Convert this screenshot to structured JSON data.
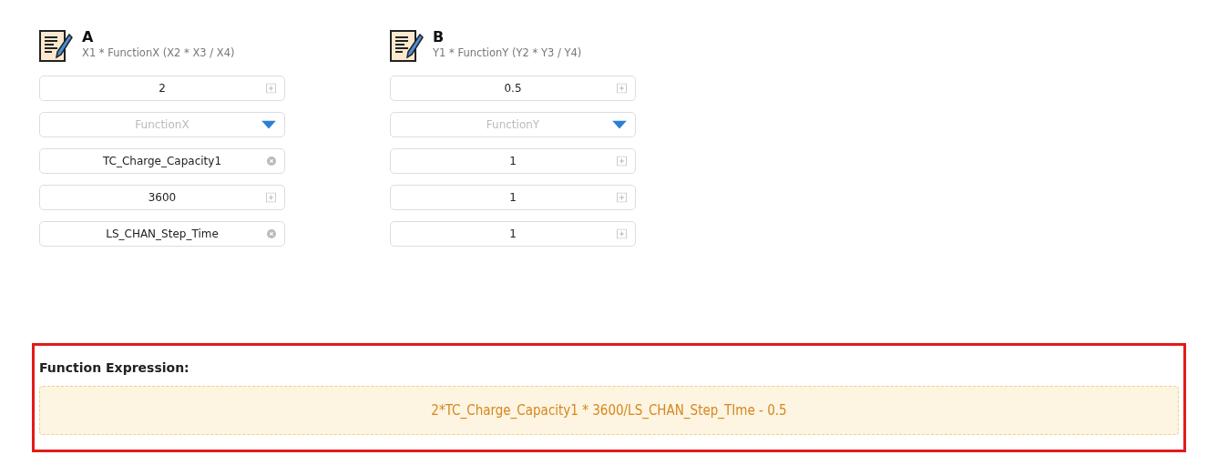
{
  "operands": [
    {
      "title": "A",
      "formula": "X1 * FunctionX (X2 * X3 / X4)",
      "fields": [
        {
          "kind": "number",
          "value": "2"
        },
        {
          "kind": "select",
          "placeholder": "FunctionX"
        },
        {
          "kind": "variable",
          "value": "TC_Charge_Capacity1"
        },
        {
          "kind": "number",
          "value": "3600"
        },
        {
          "kind": "variable",
          "value": "LS_CHAN_Step_Time"
        }
      ]
    },
    {
      "title": "B",
      "formula": "Y1 * FunctionY (Y2 * Y3 / Y4)",
      "fields": [
        {
          "kind": "number",
          "value": "0.5"
        },
        {
          "kind": "select",
          "placeholder": "FunctionY"
        },
        {
          "kind": "number",
          "value": "1"
        },
        {
          "kind": "number",
          "value": "1"
        },
        {
          "kind": "number",
          "value": "1"
        }
      ]
    }
  ],
  "expression": {
    "label": "Function Expression:",
    "value": "2*TC_Charge_Capacity1 * 3600/LS_CHAN_Step_TIme - 0.5"
  }
}
